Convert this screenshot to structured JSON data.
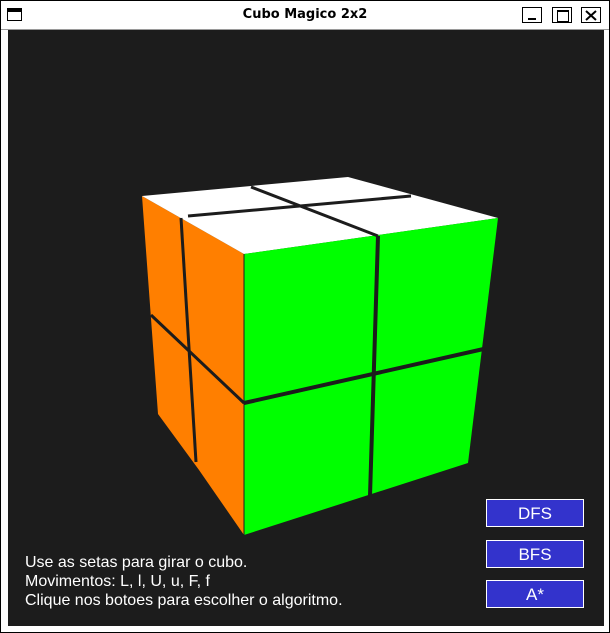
{
  "window": {
    "title": "Cubo Magico 2x2"
  },
  "colors": {
    "background": "#1c1c1c",
    "green": "#00ff00",
    "orange": "#ff7f00",
    "white": "#ffffff",
    "button": "#3333cc"
  },
  "instructions": [
    "Use as setas para girar o cubo.",
    "Movimentos: L, l, U, u, F, f",
    "Clique nos botoes para escolher o algoritmo."
  ],
  "buttons": [
    "DFS",
    "BFS",
    "A*"
  ],
  "cube": {
    "top_face": "white",
    "front_face": "green",
    "left_face": "orange"
  }
}
